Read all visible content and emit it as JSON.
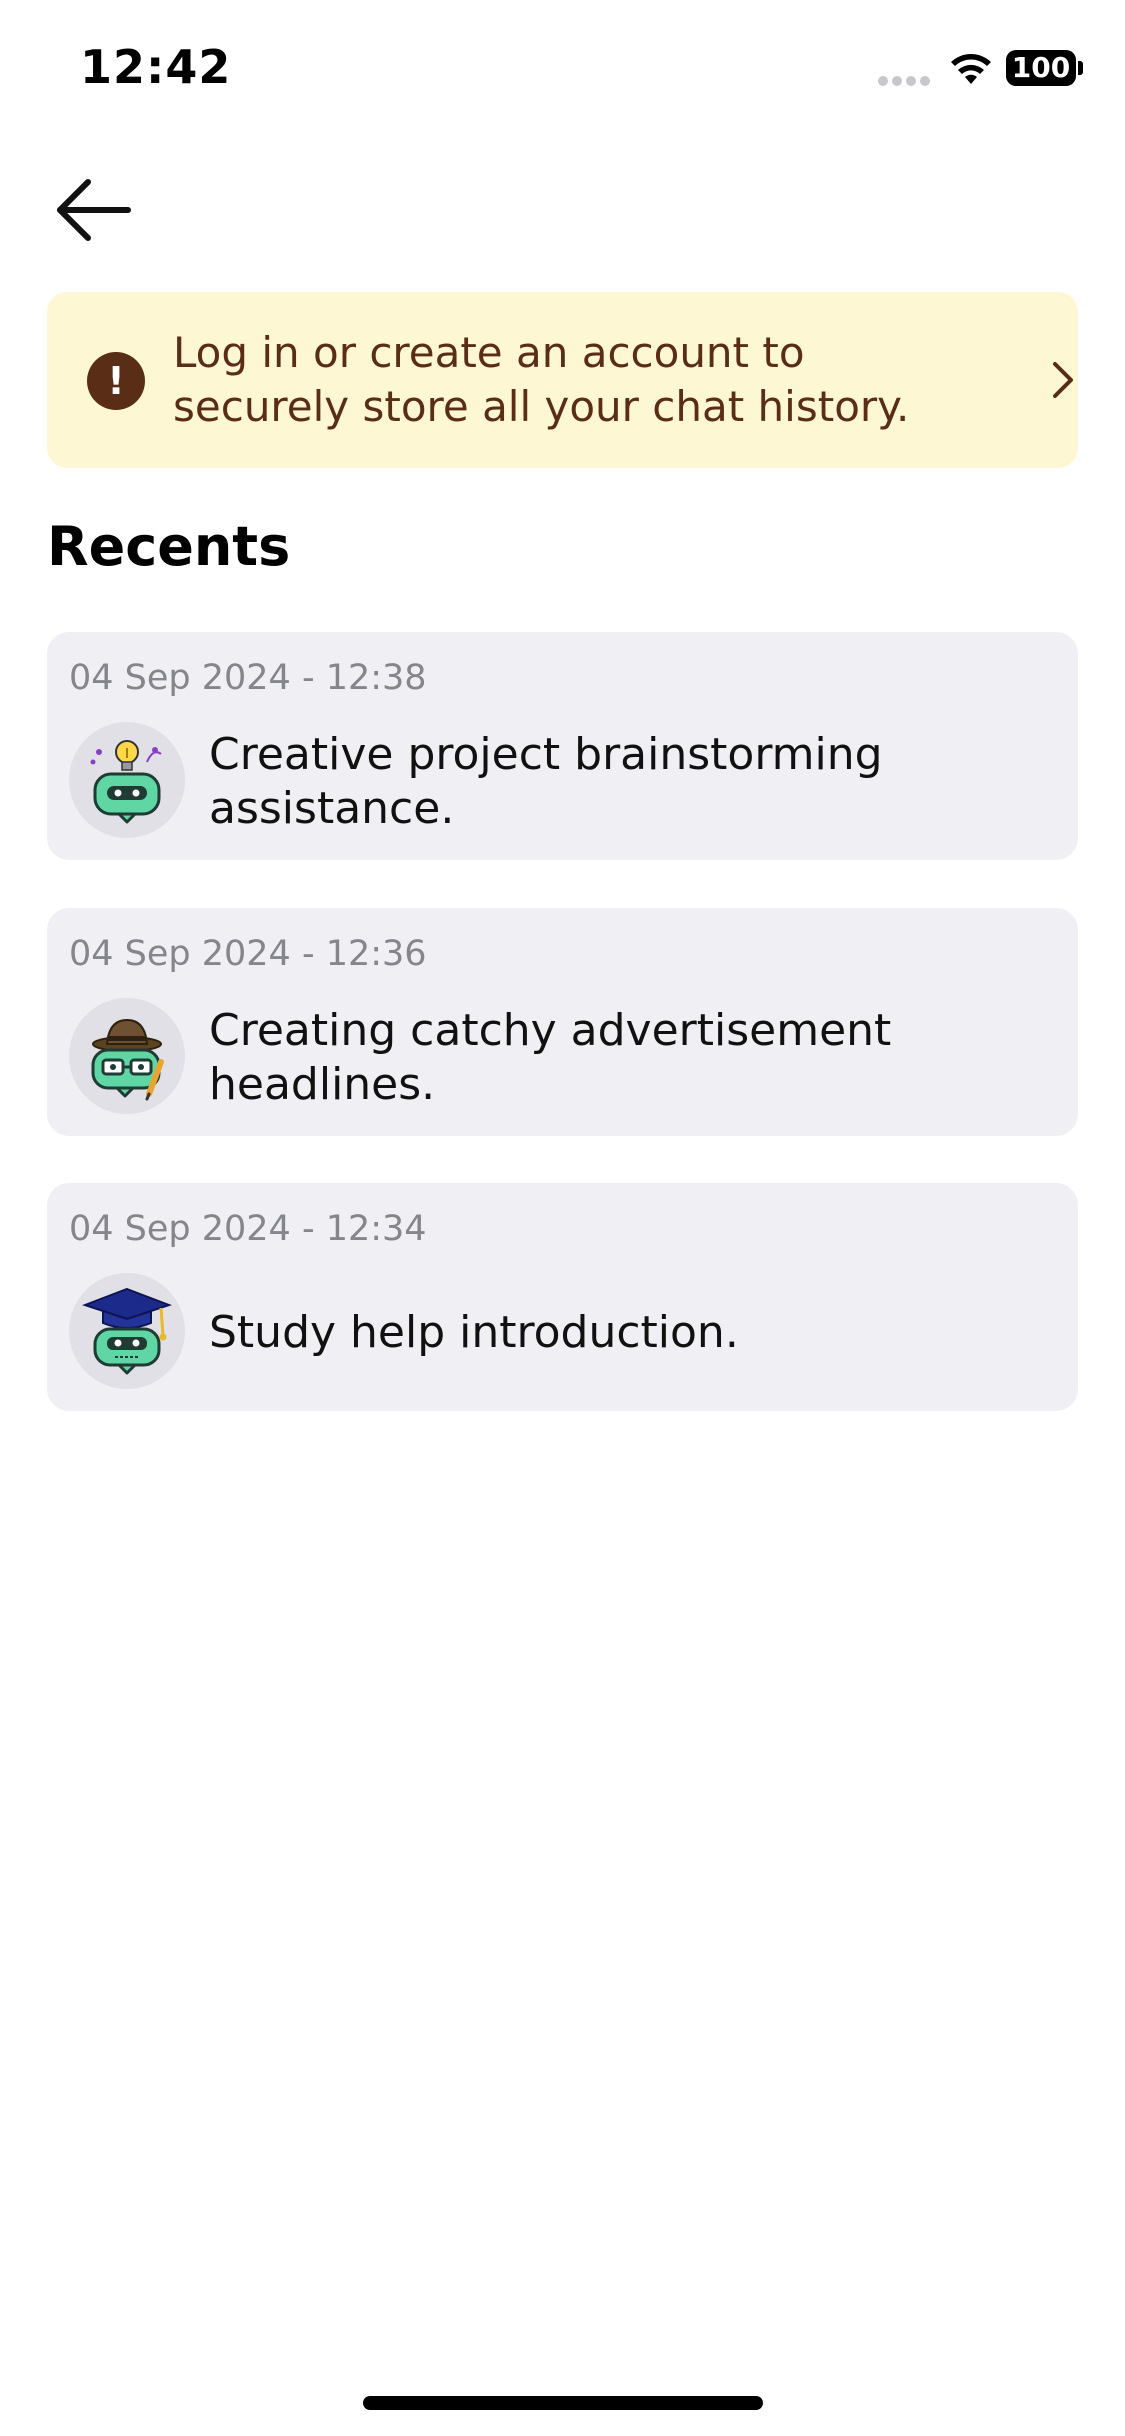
{
  "status_bar": {
    "time": "12:42",
    "battery": "100",
    "icons": [
      "signal-icon",
      "wifi-icon",
      "battery-icon"
    ]
  },
  "navigation": {
    "back_icon": "arrow-left-icon"
  },
  "banner": {
    "text": "Log in or create an account to securely store all your chat history.",
    "alert_glyph": "!",
    "alert_icon": "exclamation-circle-icon",
    "chevron_icon": "chevron-right-icon",
    "background_color": "#fef7d4",
    "text_color": "#5a2d16"
  },
  "recents": {
    "heading": "Recents",
    "items": [
      {
        "date": "04 Sep 2024 - 12:38",
        "title": "Creative project brainstorming assistance.",
        "avatar_icon": "robot-lightbulb-icon"
      },
      {
        "date": "04 Sep 2024 - 12:36",
        "title": "Creating catchy advertisement headlines.",
        "avatar_icon": "robot-detective-icon"
      },
      {
        "date": "04 Sep 2024 - 12:34",
        "title": "Study help introduction.",
        "avatar_icon": "robot-graduate-icon"
      }
    ]
  },
  "colors": {
    "card_background": "#f0eff4",
    "date_text": "#85858c",
    "robot_green": "#5fd6a4"
  }
}
